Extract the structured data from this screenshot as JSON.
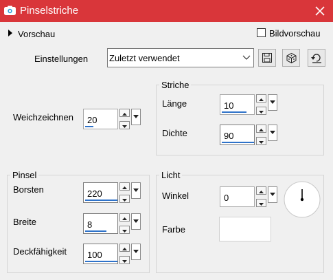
{
  "window": {
    "title": "Pinselstriche"
  },
  "header": {
    "preview_label": "Vorschau",
    "image_preview_label": "Bildvorschau",
    "image_preview_checked": false
  },
  "settings": {
    "label": "Einstellungen",
    "selected": "Zuletzt verwendet"
  },
  "smoothing": {
    "label": "Weichzeichnen",
    "value": "20"
  },
  "strokes": {
    "legend": "Striche",
    "length": {
      "label": "Länge",
      "value": "10"
    },
    "density": {
      "label": "Dichte",
      "value": "90"
    }
  },
  "brush": {
    "legend": "Pinsel",
    "bristles": {
      "label": "Borsten",
      "value": "220"
    },
    "width": {
      "label": "Breite",
      "value": "8"
    },
    "opacity": {
      "label": "Deckfähigkeit",
      "value": "100"
    }
  },
  "light": {
    "legend": "Licht",
    "angle": {
      "label": "Winkel",
      "value": "0"
    },
    "color": {
      "label": "Farbe",
      "value": "#ffffff"
    }
  },
  "colors": {
    "titlebar": "#d9363a",
    "accent": "#2e72c9"
  }
}
